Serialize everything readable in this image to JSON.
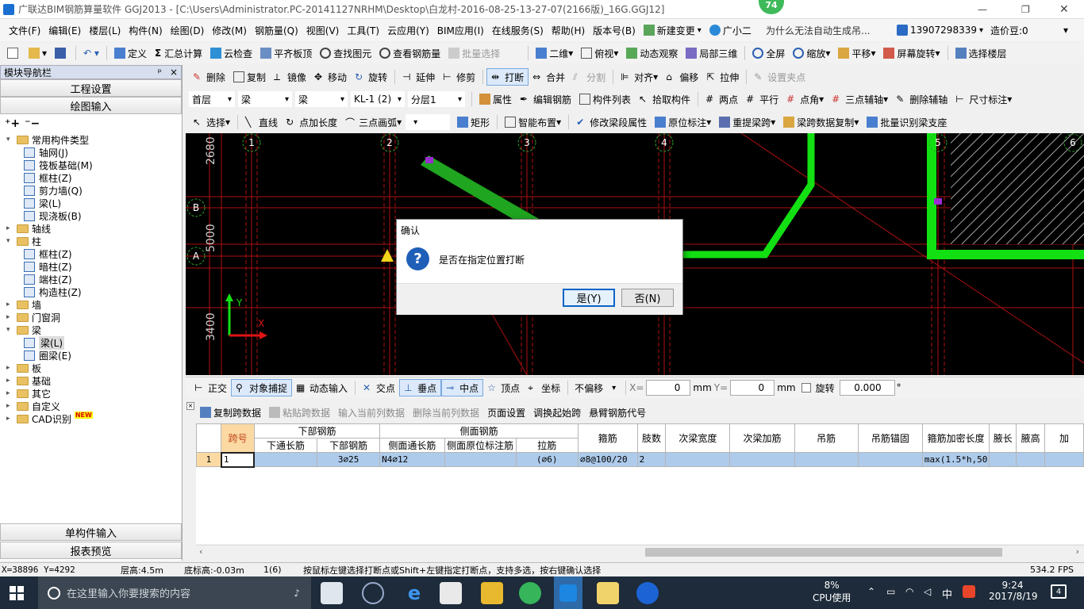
{
  "app": {
    "title": "广联达BIM钢筋算量软件 GGJ2013 - [C:\\Users\\Administrator.PC-20141127NRHM\\Desktop\\白龙村-2016-08-25-13-27-07(2166版)_16G.GGJ12]",
    "badge": "74"
  },
  "menu": [
    "文件(F)",
    "编辑(E)",
    "楼层(L)",
    "构件(N)",
    "绘图(D)",
    "修改(M)",
    "钢筋量(Q)",
    "视图(V)",
    "工具(T)",
    "云应用(Y)",
    "BIM应用(I)",
    "在线服务(S)",
    "帮助(H)",
    "版本号(B)",
    "新建变更",
    "广小二"
  ],
  "menu_right": {
    "notice": "为什么无法自动生成吊...",
    "phone": "13907298339",
    "coins": "造价豆:0"
  },
  "toolbar1": [
    "定义",
    "汇总计算",
    "云检查",
    "平齐板顶",
    "查找图元",
    "查看钢筋量",
    "批量选择",
    "二维",
    "俯视",
    "动态观察",
    "局部三维",
    "全屏",
    "缩放",
    "平移",
    "屏幕旋转",
    "选择楼层"
  ],
  "toolbar2": [
    "删除",
    "复制",
    "镜像",
    "移动",
    "旋转",
    "延伸",
    "修剪",
    "打断",
    "合并",
    "分割",
    "对齐",
    "偏移",
    "拉伸",
    "设置夹点"
  ],
  "toolbar3": {
    "dropdowns": [
      "首层",
      "梁",
      "梁",
      "KL-1 (2)",
      "分层1"
    ],
    "buttons": [
      "属性",
      "编辑钢筋",
      "构件列表",
      "拾取构件",
      "两点",
      "平行",
      "点角",
      "三点辅轴",
      "删除辅轴",
      "尺寸标注"
    ]
  },
  "toolbar4": [
    "选择",
    "直线",
    "点加长度",
    "三点画弧",
    "矩形",
    "智能布置",
    "修改梁段属性",
    "原位标注",
    "重提梁跨",
    "梁跨数据复制",
    "批量识别梁支座"
  ],
  "nav": {
    "title": "模块导航栏",
    "pin": "ᵖ",
    "close": "×",
    "btn_project": "工程设置",
    "btn_draw": "绘图输入",
    "btn_single": "单构件输入",
    "btn_report": "报表预览",
    "tree": [
      {
        "level": 0,
        "toggle": "▾",
        "type": "folder",
        "label": "常用构件类型"
      },
      {
        "level": 1,
        "type": "item",
        "label": "轴网(J)"
      },
      {
        "level": 1,
        "type": "item",
        "label": "筏板基础(M)"
      },
      {
        "level": 1,
        "type": "item",
        "label": "框柱(Z)"
      },
      {
        "level": 1,
        "type": "item",
        "label": "剪力墙(Q)"
      },
      {
        "level": 1,
        "type": "item",
        "label": "梁(L)"
      },
      {
        "level": 1,
        "type": "item",
        "label": "现浇板(B)"
      },
      {
        "level": 0,
        "toggle": "▸",
        "type": "folder",
        "label": "轴线"
      },
      {
        "level": 0,
        "toggle": "▾",
        "type": "folder",
        "label": "柱"
      },
      {
        "level": 1,
        "type": "item",
        "label": "框柱(Z)"
      },
      {
        "level": 1,
        "type": "item",
        "label": "暗柱(Z)"
      },
      {
        "level": 1,
        "type": "item",
        "label": "端柱(Z)"
      },
      {
        "level": 1,
        "type": "item",
        "label": "构造柱(Z)"
      },
      {
        "level": 0,
        "toggle": "▸",
        "type": "folder",
        "label": "墙"
      },
      {
        "level": 0,
        "toggle": "▸",
        "type": "folder",
        "label": "门窗洞"
      },
      {
        "level": 0,
        "toggle": "▾",
        "type": "folder",
        "label": "梁"
      },
      {
        "level": 1,
        "type": "item",
        "label": "梁(L)",
        "selected": true
      },
      {
        "level": 1,
        "type": "item",
        "label": "圈梁(E)"
      },
      {
        "level": 0,
        "toggle": "▸",
        "type": "folder",
        "label": "板"
      },
      {
        "level": 0,
        "toggle": "▸",
        "type": "folder",
        "label": "基础"
      },
      {
        "level": 0,
        "toggle": "▸",
        "type": "folder",
        "label": "其它"
      },
      {
        "level": 0,
        "toggle": "▸",
        "type": "folder",
        "label": "自定义"
      },
      {
        "level": 0,
        "toggle": "▸",
        "type": "folder",
        "label": "CAD识别",
        "new": "NEW"
      }
    ]
  },
  "cad": {
    "axes_top": [
      "1",
      "2",
      "3",
      "4",
      "5",
      "6"
    ],
    "axes_left": [
      "B",
      "A"
    ],
    "dims_left": [
      "2680",
      "5000",
      "3400"
    ],
    "ucs_x": "X",
    "ucs_y": "Y"
  },
  "dialog": {
    "title": "确认",
    "message": "是否在指定位置打断",
    "yes": "是(Y)",
    "no": "否(N)"
  },
  "snapbar": {
    "items": [
      "正交",
      "对象捕捉",
      "动态输入",
      "交点",
      "垂点",
      "中点",
      "顶点",
      "坐标"
    ],
    "offset_mode": "不偏移",
    "x_label": "X=",
    "x_value": "0",
    "y_label": "Y=",
    "y_value": "0",
    "unit": "mm",
    "rotate_label": "旋转",
    "rotate_value": "0.000",
    "degree": "°"
  },
  "grid_toolbar": [
    "复制跨数据",
    "粘贴跨数据",
    "输入当前列数据",
    "删除当前列数据",
    "页面设置",
    "调换起始跨",
    "悬臂钢筋代号"
  ],
  "grid": {
    "group_headers": [
      "跨号",
      "下部钢筋",
      "侧面钢筋",
      "箍筋",
      "肢数",
      "次梁宽度",
      "次梁加筋",
      "吊筋",
      "吊筋锚固",
      "箍筋加密长度",
      "腋长",
      "腋高",
      "加"
    ],
    "sub_headers": [
      "下通长筋",
      "下部钢筋",
      "侧面通长筋",
      "侧面原位标注筋",
      "拉筋"
    ],
    "rows": [
      [
        "1",
        "1",
        "",
        "3⌀25",
        "N4⌀12",
        "",
        "(⌀6)",
        "⌀8@100/20",
        "2",
        "",
        "",
        "",
        "",
        "max(1.5*h,50",
        "",
        "",
        ""
      ]
    ]
  },
  "status": {
    "coords": "X=38896 Y=4292",
    "floor_h": "层高:4.5m",
    "bottom": "底标高:-0.03m",
    "count": "1(6)",
    "hint": "按鼠标左键选择打断点或Shift+左键指定打断点，支持多选，按右键确认选择",
    "fps": "534.2 FPS"
  },
  "taskbar": {
    "search": "在这里输入你要搜索的内容",
    "cpu_pct": "8%",
    "cpu_label": "CPU使用",
    "ime": "中",
    "time": "9:24",
    "date": "2017/8/19",
    "notif": "4"
  }
}
